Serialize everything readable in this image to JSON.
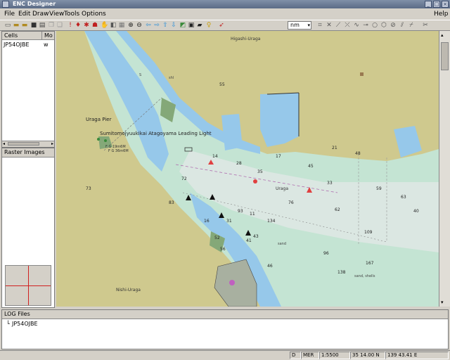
{
  "window": {
    "title": "ENC Designer"
  },
  "menu": {
    "items": [
      "File",
      "Edit",
      "Draw",
      "View",
      "Tools",
      "Options"
    ],
    "help": "Help"
  },
  "toolbar": {
    "unit": "nm"
  },
  "cells_panel": {
    "col_cells": "Cells",
    "col_mode": "Mo",
    "rows": [
      {
        "name": "JP54OJBE",
        "mode": "w"
      }
    ]
  },
  "raster_panel": {
    "title": "Raster Images"
  },
  "log_panel": {
    "title": "LOG Files",
    "items": [
      "JP54OJBE"
    ]
  },
  "status": {
    "d": "D",
    "proj": "MER",
    "scale": "1:5500",
    "lat": "35 14.00 N",
    "lon": "139 43.41 E"
  },
  "map": {
    "places": [
      "Higashi-Uraga",
      "Uraga Pier",
      "Sumitomojyuukikai Atagoyama Leading Light",
      "Uraga",
      "Nishi-Uraga"
    ],
    "lights": [
      "F G 19m6M",
      "F G 36m6M"
    ],
    "depths": [
      "55",
      "73",
      "14",
      "28",
      "35",
      "45",
      "17",
      "21",
      "33",
      "59",
      "63",
      "40",
      "62",
      "93",
      "72",
      "76",
      "11",
      "134",
      "167",
      "96",
      "41",
      "138",
      "109",
      "43",
      "31",
      "16",
      "46",
      "56",
      "52",
      "83",
      "48"
    ],
    "seabed": [
      "S",
      "shl",
      "sand",
      "sand, shells"
    ],
    "colors": {
      "land": "#cfc98e",
      "deep": "#a8d5c6",
      "mid": "#c4e4d3",
      "shallow": "#96c8ea",
      "drying": "#84a878",
      "dredged": "#dbe7e2"
    }
  }
}
